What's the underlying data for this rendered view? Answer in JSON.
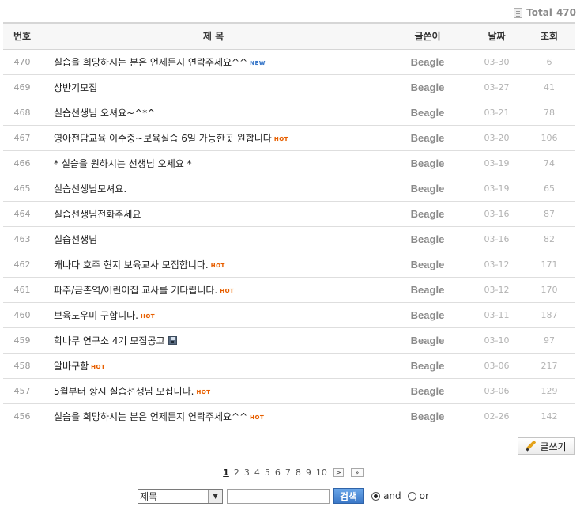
{
  "total": {
    "label": "Total",
    "count": "470"
  },
  "columns": {
    "num": "번호",
    "subject": "제 목",
    "author": "글쓴이",
    "date": "날짜",
    "views": "조회"
  },
  "posts": [
    {
      "num": "470",
      "subject": "실습을 희망하시는 분은 언제든지 연락주세요^^",
      "badge": "NEW",
      "author": "Beagle",
      "date": "03-30",
      "views": "6"
    },
    {
      "num": "469",
      "subject": "상반기모집",
      "badge": "",
      "author": "Beagle",
      "date": "03-27",
      "views": "41"
    },
    {
      "num": "468",
      "subject": "실습선생님 오셔요~^*^",
      "badge": "",
      "author": "Beagle",
      "date": "03-21",
      "views": "78"
    },
    {
      "num": "467",
      "subject": "영아전담교육 이수중~보육실습 6일 가능한곳 원합니다",
      "badge": "HOT",
      "author": "Beagle",
      "date": "03-20",
      "views": "106"
    },
    {
      "num": "466",
      "subject": "* 실습을 원하시는 선생님 오세요 *",
      "badge": "",
      "author": "Beagle",
      "date": "03-19",
      "views": "74"
    },
    {
      "num": "465",
      "subject": "실습선생님모셔요.",
      "badge": "",
      "author": "Beagle",
      "date": "03-19",
      "views": "65"
    },
    {
      "num": "464",
      "subject": "실습선생님전화주세요",
      "badge": "",
      "author": "Beagle",
      "date": "03-16",
      "views": "87"
    },
    {
      "num": "463",
      "subject": "실습선생님",
      "badge": "",
      "author": "Beagle",
      "date": "03-16",
      "views": "82"
    },
    {
      "num": "462",
      "subject": "캐나다 호주 현지 보육교사 모집합니다.",
      "badge": "HOT",
      "author": "Beagle",
      "date": "03-12",
      "views": "171"
    },
    {
      "num": "461",
      "subject": "파주/금촌역/어린이집 교사를 기다립니다.",
      "badge": "HOT",
      "author": "Beagle",
      "date": "03-12",
      "views": "170"
    },
    {
      "num": "460",
      "subject": "보육도우미 구합니다.",
      "badge": "HOT",
      "author": "Beagle",
      "date": "03-11",
      "views": "187"
    },
    {
      "num": "459",
      "subject": "학나무 연구소 4기 모집공고",
      "badge": "FILE",
      "author": "Beagle",
      "date": "03-10",
      "views": "97"
    },
    {
      "num": "458",
      "subject": "알바구함",
      "badge": "HOT",
      "author": "Beagle",
      "date": "03-06",
      "views": "217"
    },
    {
      "num": "457",
      "subject": "5월부터 항시 실습선생님 모십니다.",
      "badge": "HOT",
      "author": "Beagle",
      "date": "03-06",
      "views": "129"
    },
    {
      "num": "456",
      "subject": "실습을 희망하시는 분은 언제든지 연락주세요^^",
      "badge": "HOT",
      "author": "Beagle",
      "date": "02-26",
      "views": "142"
    }
  ],
  "write_button": {
    "label": "글쓰기",
    "icon": "pencil-icon"
  },
  "pagination": {
    "pages": [
      "1",
      "2",
      "3",
      "4",
      "5",
      "6",
      "7",
      "8",
      "9",
      "10"
    ],
    "current": "1",
    "next": ">",
    "last": "»"
  },
  "search": {
    "field_selected": "제목",
    "query_value": "",
    "button_label": "검색",
    "radio_and": "and",
    "radio_or": "or",
    "radio_selected": "and"
  },
  "colors": {
    "accent": "#3b78c8",
    "hot": "#e65c00",
    "new": "#3a78c8"
  }
}
